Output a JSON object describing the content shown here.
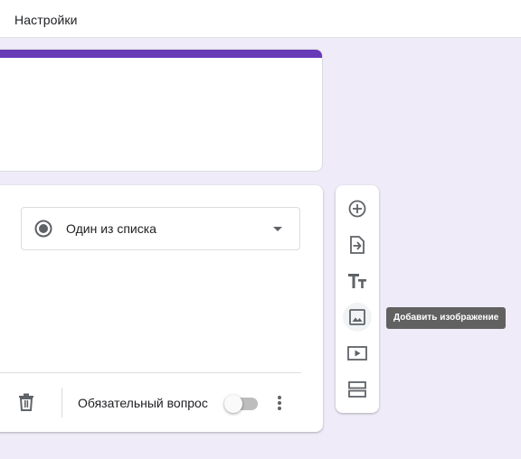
{
  "topbar": {
    "settings_tab": "Настройки"
  },
  "colors": {
    "accent": "#673ab7",
    "background": "#f0ebf8",
    "icon": "#5f6368",
    "tooltip_bg": "#616161"
  },
  "question": {
    "type_icon": "radio-button-checked-icon",
    "type_label": "Один из списка",
    "required_label": "Обязательный вопрос",
    "required_on": false
  },
  "toolbar": {
    "items": [
      {
        "icon": "add-circle-icon",
        "name": "add-question"
      },
      {
        "icon": "import-questions-icon",
        "name": "import-questions"
      },
      {
        "icon": "title-text-icon",
        "name": "add-title"
      },
      {
        "icon": "image-icon",
        "name": "add-image"
      },
      {
        "icon": "video-icon",
        "name": "add-video"
      },
      {
        "icon": "section-icon",
        "name": "add-section"
      }
    ],
    "tooltip": "Добавить изображение"
  }
}
